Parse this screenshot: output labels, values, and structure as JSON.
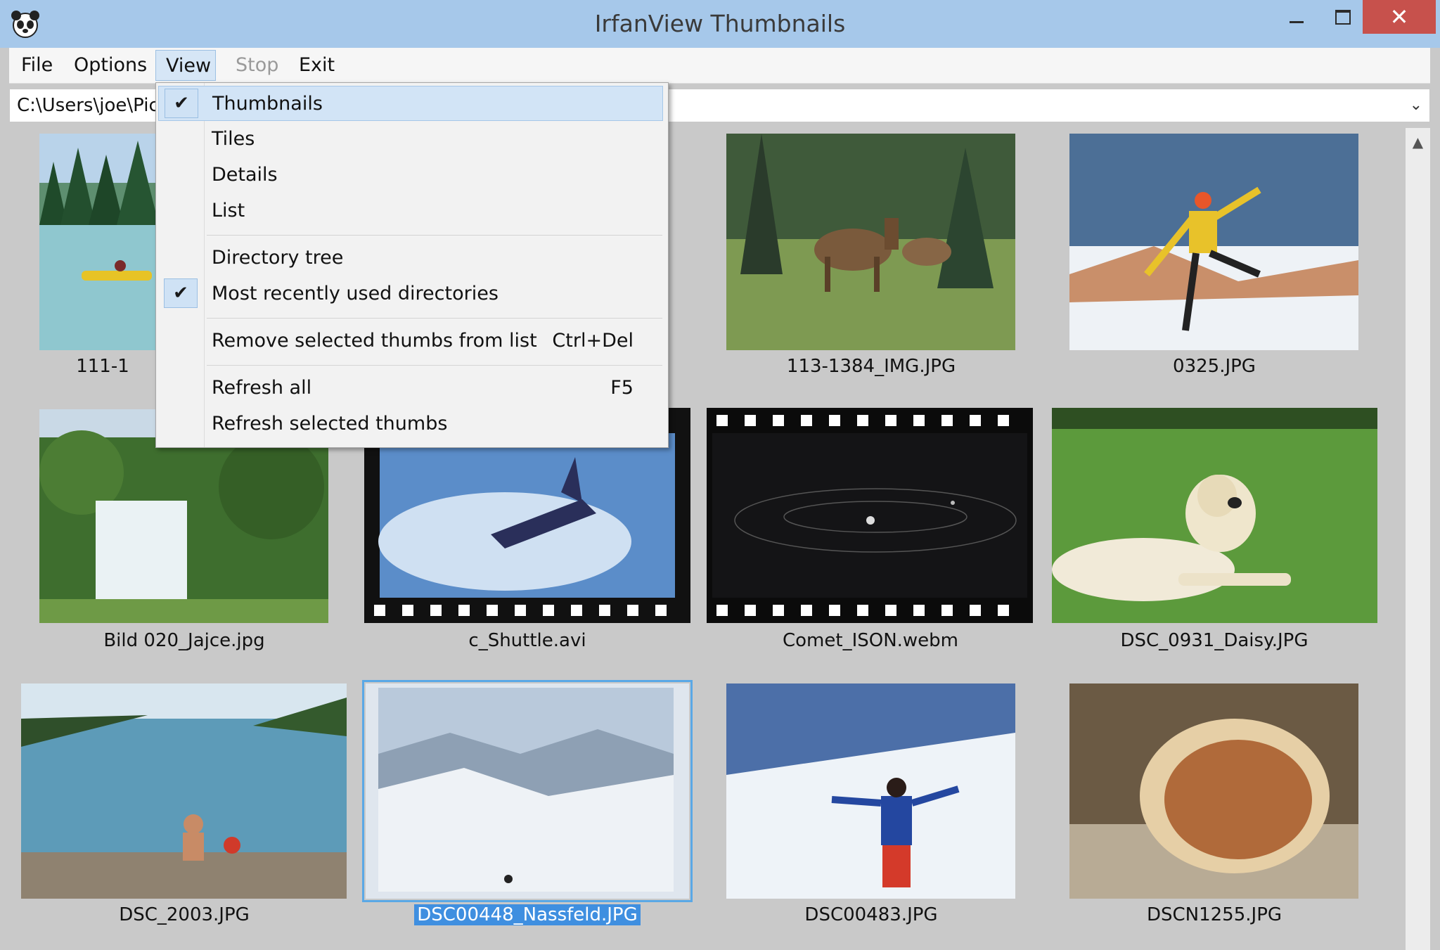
{
  "window": {
    "title": "IrfanView Thumbnails",
    "close_glyph": "✕"
  },
  "menubar": {
    "file": "File",
    "options": "Options",
    "view": "View",
    "stop": "Stop",
    "exit": "Exit"
  },
  "address": {
    "path": "C:\\Users\\joe\\Pict",
    "arrow": "⌄"
  },
  "view_menu": {
    "thumbnails": "Thumbnails",
    "tiles": "Tiles",
    "details": "Details",
    "list": "List",
    "directory_tree": "Directory tree",
    "mru_dirs": "Most recently used directories",
    "remove_selected": "Remove selected thumbs from list",
    "remove_shortcut": "Ctrl+Del",
    "refresh_all": "Refresh all",
    "refresh_all_shortcut": "F5",
    "refresh_selected": "Refresh selected thumbs",
    "check": "✔"
  },
  "thumbnails": [
    {
      "name": "111-1"
    },
    {
      "name": "113-1384_IMG.JPG"
    },
    {
      "name": "0325.JPG"
    },
    {
      "name": "Bild 020_Jajce.jpg"
    },
    {
      "name": "c_Shuttle.avi"
    },
    {
      "name": "Comet_ISON.webm"
    },
    {
      "name": "DSC_0931_Daisy.JPG"
    },
    {
      "name": "DSC_2003.JPG"
    },
    {
      "name": "DSC00448_Nassfeld.JPG"
    },
    {
      "name": "DSC00483.JPG"
    },
    {
      "name": "DSCN1255.JPG"
    }
  ],
  "scrollbar": {
    "up_arrow": "▲"
  }
}
